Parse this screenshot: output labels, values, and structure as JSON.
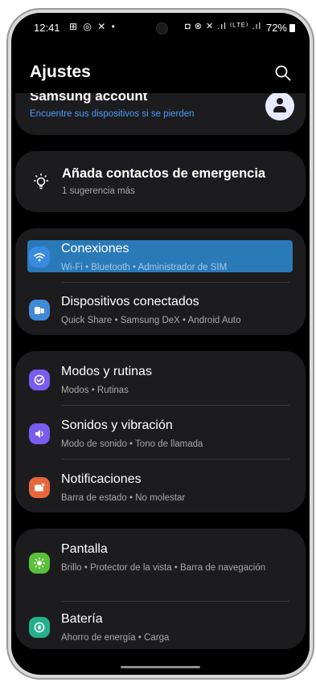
{
  "status_bar": {
    "time": "12:41",
    "left_icons": "⊞ ◎ ✕ •",
    "right_icons": "◘ ⊗ ✕ .ıl ⁽ᴸᵀᴱ⁾ .ıl",
    "battery": "72%"
  },
  "header": {
    "title": "Ajustes",
    "search_icon": "search-icon"
  },
  "account": {
    "title": "Samsung account",
    "subtitle": "Encuentre sus dispositivos si se pierden"
  },
  "suggestion": {
    "title": "Añada contactos de emergencia",
    "subtitle": "1 sugerencia más"
  },
  "groups": [
    {
      "items": [
        {
          "label": "Conexiones",
          "sub": "Wi-Fi  •  Bluetooth  •  Administrador de SIM",
          "icon": "wifi-icon",
          "color": "#3f8ad8",
          "selected": true
        },
        {
          "label": "Dispositivos conectados",
          "sub": "Quick Share  •  Samsung DeX  •  Android Auto",
          "icon": "devices-icon",
          "color": "#3f8ad8"
        }
      ]
    },
    {
      "items": [
        {
          "label": "Modos y rutinas",
          "sub": "Modos  •  Rutinas",
          "icon": "modes-icon",
          "color": "#7a5cf0"
        },
        {
          "label": "Sonidos y vibración",
          "sub": "Modo de sonido  •  Tono de llamada",
          "icon": "sound-icon",
          "color": "#7a5cf0"
        },
        {
          "label": "Notificaciones",
          "sub": "Barra de estado  •  No molestar",
          "icon": "notifications-icon",
          "color": "#e8663a"
        }
      ]
    },
    {
      "items": [
        {
          "label": "Pantalla",
          "sub": "Brillo  •  Protector de la vista  •  Barra de navegación",
          "icon": "display-icon",
          "color": "#5bbf3b"
        },
        {
          "label": "Batería",
          "sub": "Ahorro de energía  •  Carga",
          "icon": "battery-icon",
          "color": "#25b08c"
        }
      ]
    }
  ]
}
